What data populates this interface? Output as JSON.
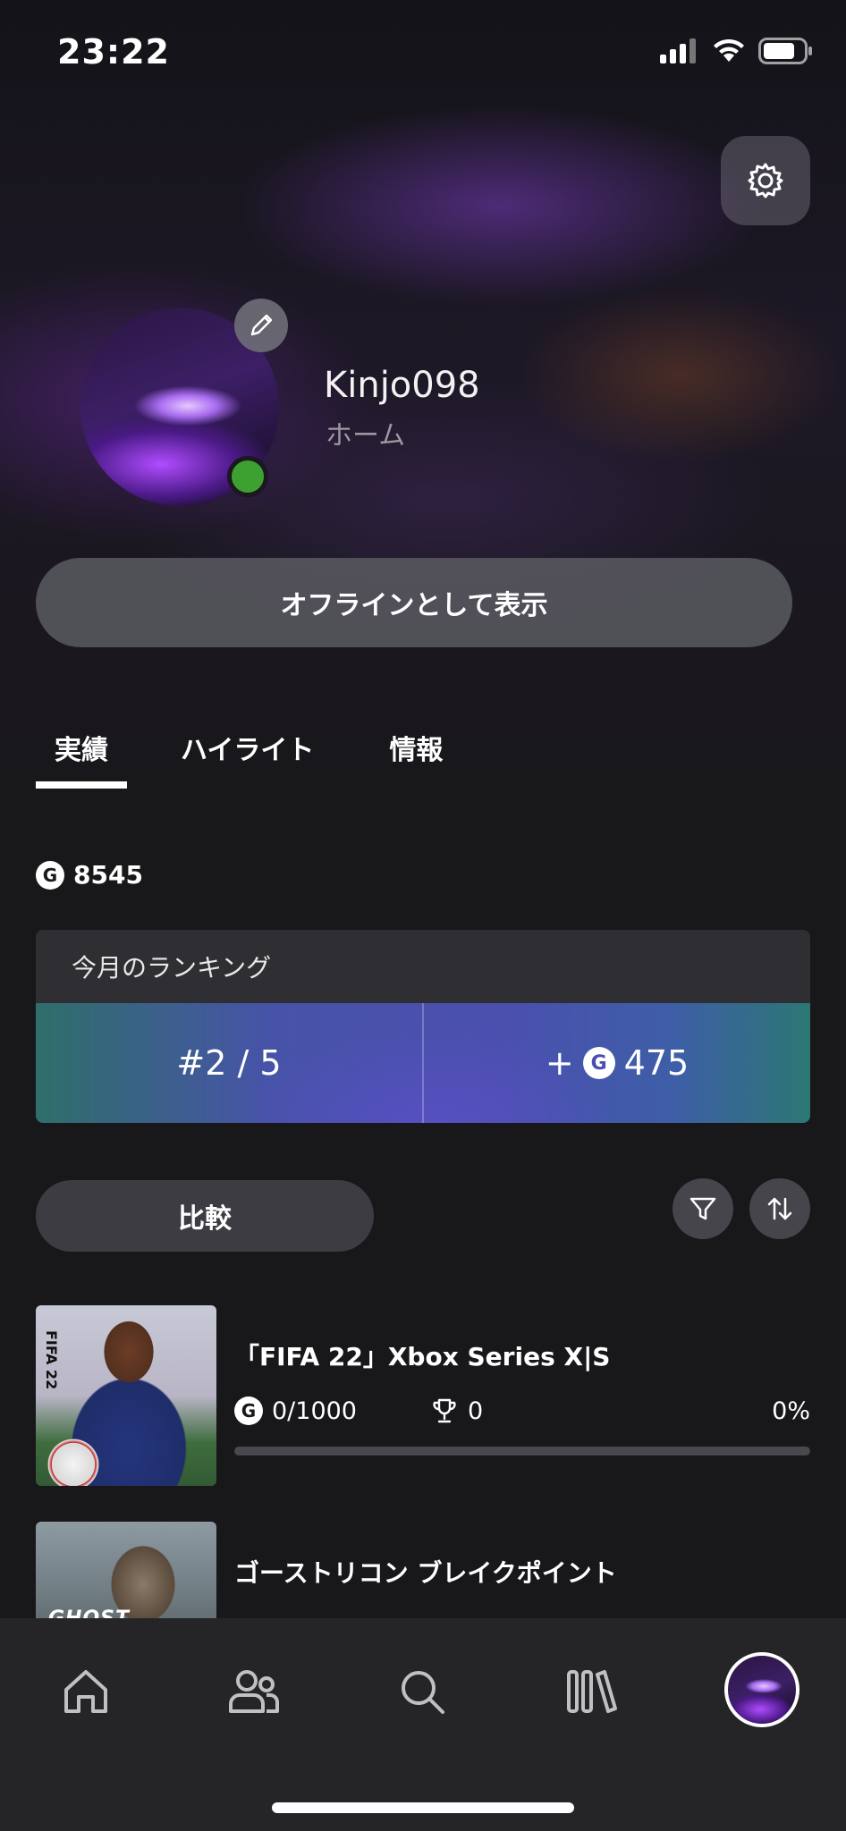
{
  "status_bar": {
    "time": "23:22"
  },
  "profile": {
    "gamertag": "Kinjo098",
    "presence": "ホーム",
    "offline_button": "オフラインとして表示"
  },
  "tabs": [
    {
      "label": "実績",
      "active": true
    },
    {
      "label": "ハイライト",
      "active": false
    },
    {
      "label": "情報",
      "active": false
    }
  ],
  "gamerscore": {
    "icon": "G",
    "total": "8545"
  },
  "ranking": {
    "title": "今月のランキング",
    "position": "#2 / 5",
    "gain_prefix": "+",
    "gain": "475"
  },
  "controls": {
    "compare_label": "比較"
  },
  "games": [
    {
      "title": "「FIFA 22」Xbox Series X|S",
      "thumb_label": "FIFA 22",
      "gamerscore": "0/1000",
      "trophies": "0",
      "percent": "0%",
      "progress": 0
    },
    {
      "title": "ゴーストリコン ブレイクポイント",
      "thumb_label": "GHOST RECON",
      "gamerscore": "",
      "trophies": "",
      "percent": "",
      "progress": 0
    }
  ],
  "colors": {
    "online": "#3da132",
    "accent_blue": "#4b4fae",
    "accent_teal": "#2f6e6a"
  },
  "nav": [
    "home-icon",
    "social-icon",
    "search-icon",
    "library-icon",
    "profile-avatar"
  ]
}
